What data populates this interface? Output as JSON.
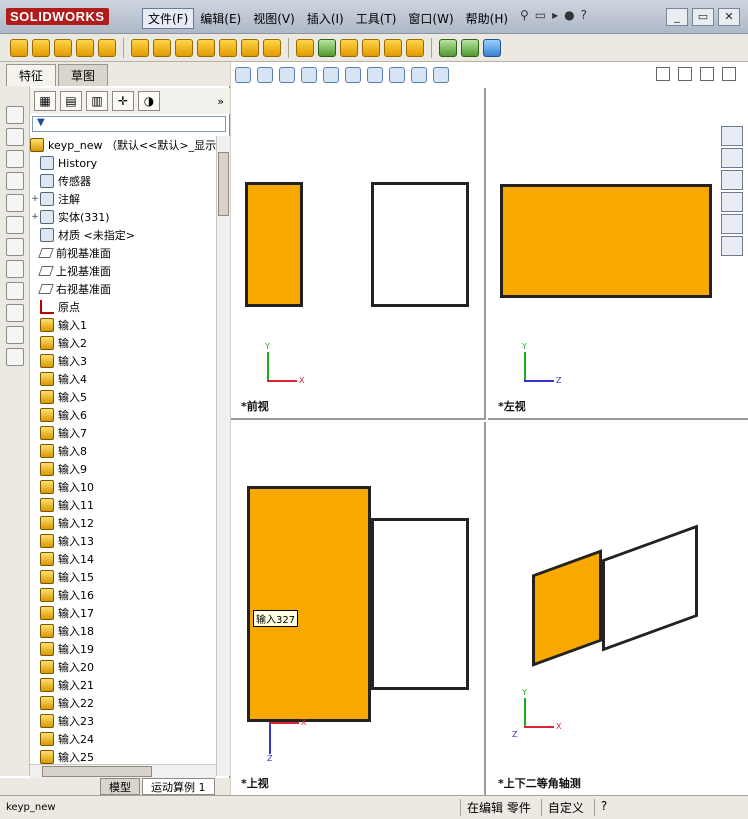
{
  "app": {
    "name": "SOLIDWORKS"
  },
  "menu": [
    {
      "label": "文件(F)",
      "active": true
    },
    {
      "label": "编辑(E)"
    },
    {
      "label": "视图(V)"
    },
    {
      "label": "插入(I)"
    },
    {
      "label": "工具(T)"
    },
    {
      "label": "窗口(W)"
    },
    {
      "label": "帮助(H)"
    }
  ],
  "panel_tabs": [
    "特征",
    "草图"
  ],
  "tree": {
    "root": "keyp_new （默认<<默认>_显示",
    "items": [
      {
        "label": "History",
        "icon": "history-icon",
        "expand": ""
      },
      {
        "label": "传感器",
        "icon": "sensor-icon",
        "expand": ""
      },
      {
        "label": "注解",
        "icon": "annotation-icon",
        "expand": "+"
      },
      {
        "label": "实体(331)",
        "icon": "solid-bodies-icon",
        "expand": "+"
      },
      {
        "label": "材质 <未指定>",
        "icon": "material-icon",
        "expand": ""
      },
      {
        "label": "前视基准面",
        "icon": "plane-icon",
        "expand": ""
      },
      {
        "label": "上视基准面",
        "icon": "plane-icon",
        "expand": ""
      },
      {
        "label": "右视基准面",
        "icon": "plane-icon",
        "expand": ""
      },
      {
        "label": "原点",
        "icon": "origin-icon",
        "expand": ""
      },
      {
        "label": "输入1"
      },
      {
        "label": "输入2"
      },
      {
        "label": "输入3"
      },
      {
        "label": "输入4"
      },
      {
        "label": "输入5"
      },
      {
        "label": "输入6"
      },
      {
        "label": "输入7"
      },
      {
        "label": "输入8"
      },
      {
        "label": "输入9"
      },
      {
        "label": "输入10"
      },
      {
        "label": "输入11"
      },
      {
        "label": "输入12"
      },
      {
        "label": "输入13"
      },
      {
        "label": "输入14"
      },
      {
        "label": "输入15"
      },
      {
        "label": "输入16"
      },
      {
        "label": "输入17"
      },
      {
        "label": "输入18"
      },
      {
        "label": "输入19"
      },
      {
        "label": "输入20"
      },
      {
        "label": "输入21"
      },
      {
        "label": "输入22"
      },
      {
        "label": "输入23"
      },
      {
        "label": "输入24"
      },
      {
        "label": "输入25"
      }
    ]
  },
  "bottom_tabs": [
    "模型",
    "运动算例 1"
  ],
  "viewports": {
    "front": "*前视",
    "left": "*左视",
    "top": "*上视",
    "iso": "*上下二等角轴测"
  },
  "tooltip": "输入327",
  "status": {
    "file": "keyp_new",
    "mode": "在编辑 零件",
    "custom": "自定义"
  },
  "axes": {
    "x": "X",
    "y": "Y",
    "z": "Z"
  }
}
